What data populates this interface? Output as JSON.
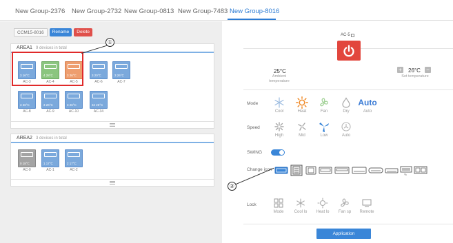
{
  "tabs": [
    {
      "label": "New Group-2376"
    },
    {
      "label": "New Group-2732"
    },
    {
      "label": "New Group-0813"
    },
    {
      "label": "New Group-7483"
    },
    {
      "label": "New Group-8016",
      "active": true
    }
  ],
  "toolbar": {
    "group_id": "CCM15-8016",
    "rename_label": "Rename",
    "delete_label": "Delete"
  },
  "areas": [
    {
      "title": "AREA1",
      "count_text": "9 devices in total",
      "devices": [
        {
          "name": "AC-3",
          "status": "3  16°C",
          "state": "blue"
        },
        {
          "name": "AC-4",
          "status": "4  28°C",
          "state": "green"
        },
        {
          "name": "AC-5",
          "status": "3  26°C",
          "state": "orange"
        },
        {
          "name": "AC-6",
          "status": "3  20°C",
          "state": "blue"
        },
        {
          "name": "AC-7",
          "status": "3  26°C",
          "state": "blue"
        },
        {
          "name": "AC-8",
          "status": "3  26°C",
          "state": "blue"
        },
        {
          "name": "AC-9",
          "status": "3  26°C",
          "state": "blue"
        },
        {
          "name": "AC-10",
          "status": "3  26°C",
          "state": "blue"
        },
        {
          "name": "AC-34",
          "status": "34  26°C",
          "state": "blue"
        }
      ]
    },
    {
      "title": "AREA2",
      "count_text": "3 devices in total",
      "devices": [
        {
          "name": "AC-0",
          "status": "0  18°C",
          "state": "gray"
        },
        {
          "name": "AC-1",
          "status": "1  17°C",
          "state": "blue"
        },
        {
          "name": "AC-2",
          "status": "2  17°C",
          "state": "blue"
        }
      ]
    }
  ],
  "callouts": {
    "one": "①",
    "two": "②"
  },
  "control": {
    "selected_device": "AC-5",
    "ambient": {
      "value": "25°C",
      "label": "Ambient temperature"
    },
    "set": {
      "value": "26°C",
      "label": "Set temperature",
      "plus": "+",
      "minus": "−"
    },
    "mode": {
      "label": "Mode",
      "options": [
        {
          "label": "Cool",
          "icon": "snowflake-icon",
          "selected": false
        },
        {
          "label": "Heat",
          "icon": "sun-icon",
          "selected": true
        },
        {
          "label": "Fan",
          "icon": "fan-icon",
          "selected": false
        },
        {
          "label": "Dry",
          "icon": "droplet-icon",
          "selected": false
        },
        {
          "label": "Auto",
          "icon": "auto-text",
          "selected": false
        }
      ]
    },
    "speed": {
      "label": "Speed",
      "options": [
        {
          "label": "High",
          "icon": "fan-high-icon",
          "selected": false
        },
        {
          "label": "Mid",
          "icon": "fan-mid-icon",
          "selected": false
        },
        {
          "label": "Low",
          "icon": "fan-low-icon",
          "selected": true
        },
        {
          "label": "Auto",
          "icon": "fan-auto-icon",
          "selected": false
        }
      ]
    },
    "swing": {
      "label": "SWING",
      "on": true
    },
    "change_icon": {
      "label": "Change icon",
      "extra_label": "%"
    },
    "lock": {
      "label": "Lock",
      "options": [
        {
          "label": "Mode",
          "icon": "mode-lock-icon"
        },
        {
          "label": "Cool lo",
          "icon": "cool-lock-icon"
        },
        {
          "label": "Heat lo",
          "icon": "heat-lock-icon"
        },
        {
          "label": "Fan sp",
          "icon": "fan-lock-icon"
        },
        {
          "label": "Remote",
          "icon": "remote-icon"
        }
      ]
    },
    "apply_label": "Application"
  },
  "colors": {
    "accent": "#3a86d8",
    "power": "#e2463d",
    "heat": "#f08c2b",
    "delete": "#e0504b",
    "callout": "#e02a2a"
  }
}
